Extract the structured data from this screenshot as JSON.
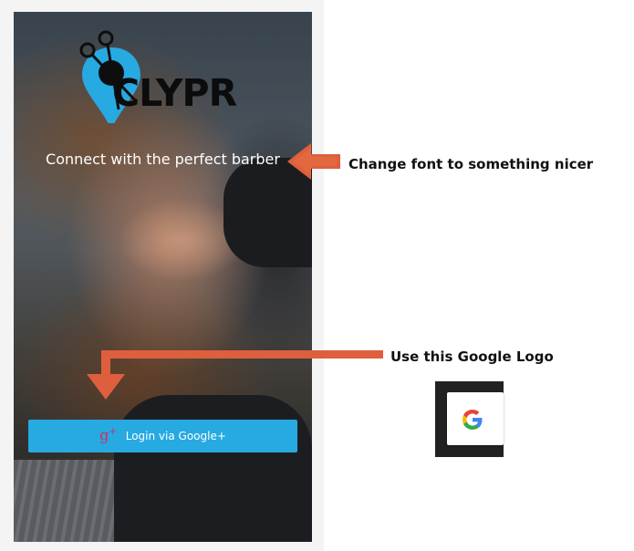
{
  "app": {
    "logo_text": "CLYPR",
    "tagline": "Connect with the perfect barber",
    "login_button": {
      "icon_text": "g",
      "label": "Login via Google+"
    }
  },
  "annotations": {
    "font_note": "Change font to something nicer",
    "logo_note": "Use this Google Logo"
  },
  "colors": {
    "button": "#27a9e1",
    "logo_pin": "#27a9e1",
    "arrow": "#de5f3e",
    "gplus_icon": "#d0305a"
  }
}
